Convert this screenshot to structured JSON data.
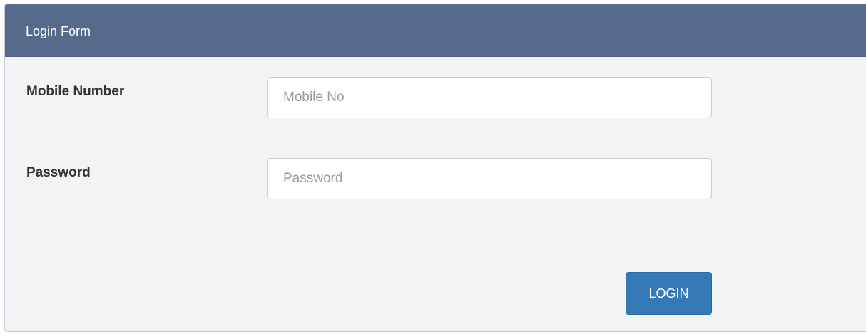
{
  "form": {
    "title": "Login Form",
    "fields": [
      {
        "label": "Mobile Number",
        "value": "",
        "placeholder": "Mobile No"
      },
      {
        "label": "Password",
        "value": "",
        "placeholder": "Password"
      }
    ],
    "submit_label": "LOGIN"
  },
  "colors": {
    "header_bg": "#566b8c",
    "panel_bg": "#f2f3f5",
    "button_bg": "#337ab7",
    "label_text": "#333333"
  }
}
